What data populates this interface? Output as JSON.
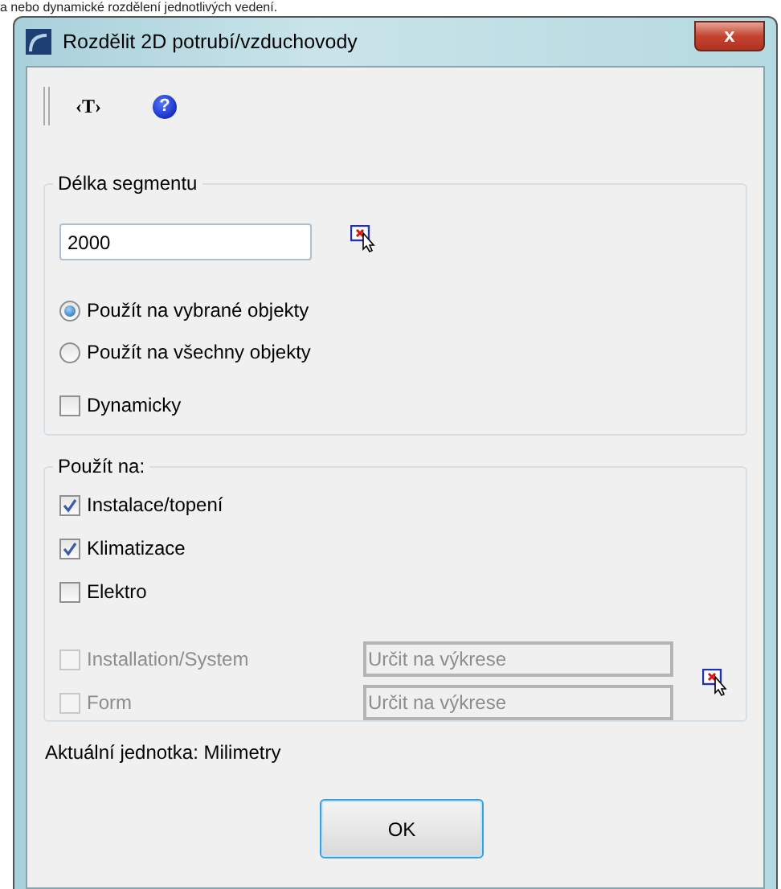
{
  "background_text": "a nebo dynamické rozdělení jednotlivých vedení.",
  "window": {
    "title": "Rozdělit 2D potrubí/vzduchovody",
    "close_label": "x"
  },
  "toolbar": {
    "text_button": "‹T›",
    "help_label": "?"
  },
  "segment_group": {
    "title": "Délka segmentu",
    "length": "2000",
    "options": [
      {
        "label": "Použít na vybrané objekty",
        "selected": true
      },
      {
        "label": "Použít na všechny objekty",
        "selected": false
      }
    ],
    "dynamic": {
      "label": "Dynamicky",
      "checked": false
    }
  },
  "apply_group": {
    "title": "Použít na:",
    "items": [
      {
        "label": "Instalace/topení",
        "checked": true,
        "disabled": false
      },
      {
        "label": "Klimatizace",
        "checked": true,
        "disabled": false
      },
      {
        "label": "Elektro",
        "checked": false,
        "disabled": false
      }
    ],
    "rows": [
      {
        "label": "Installation/System",
        "checked": false,
        "disabled": true,
        "placeholder": "Určit na výkrese"
      },
      {
        "label": "Form",
        "checked": false,
        "disabled": true,
        "placeholder": "Určit na výkrese"
      }
    ]
  },
  "unit_label": "Aktuální jednotka: Milimetry",
  "ok_button": "OK"
}
